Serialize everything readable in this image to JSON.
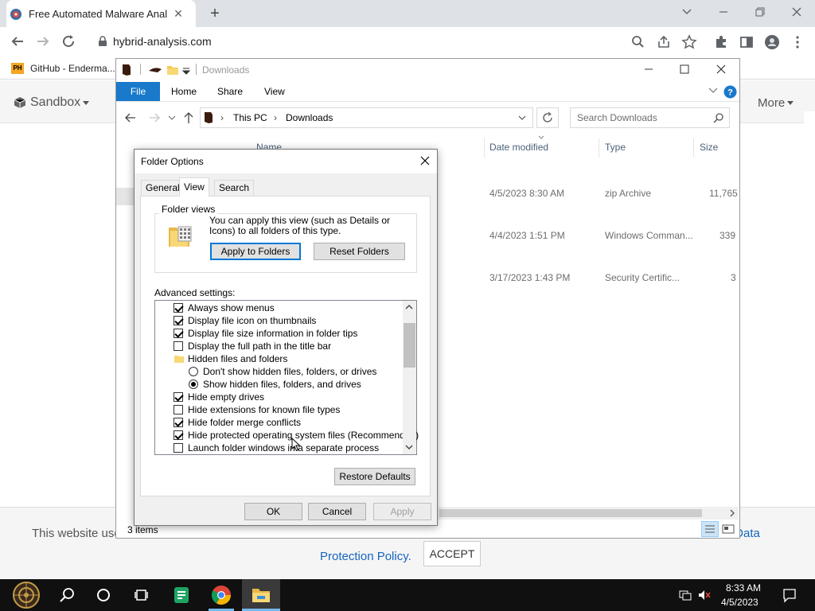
{
  "browser": {
    "tab_title": "Free Automated Malware Anal",
    "url": "hybrid-analysis.com",
    "bookmark_label": "GitHub - Enderma...",
    "bookmark_badge": "PH",
    "new_tab": "+",
    "tab_close": "✕"
  },
  "page": {
    "nav_sandbox": "Sandbox",
    "nav_more": "More",
    "cookie_text_start": "This website use",
    "cookie_text_end": "r Data",
    "cookie_link": "Protection Policy.",
    "accept_label": "ACCEPT"
  },
  "explorer": {
    "title": "Downloads",
    "ribbon": {
      "file": "File",
      "home": "Home",
      "share": "Share",
      "view": "View"
    },
    "breadcrumb": [
      "This PC",
      "Downloads"
    ],
    "search_placeholder": "Search Downloads",
    "columns": {
      "name": "Name",
      "date": "Date modified",
      "type": "Type",
      "size": "Size"
    },
    "rows": [
      {
        "date": "4/5/2023 8:30 AM",
        "type": "zip Archive",
        "size": "11,765"
      },
      {
        "date": "4/4/2023 1:51 PM",
        "type": "Windows Comman...",
        "size": "339"
      },
      {
        "date": "3/17/2023 1:43 PM",
        "type": "Security Certific...",
        "size": "3"
      }
    ],
    "status": "3 items"
  },
  "dialog": {
    "title": "Folder Options",
    "tabs": {
      "general": "General",
      "view": "View",
      "search": "Search"
    },
    "folder_views": {
      "label": "Folder views",
      "text": "You can apply this view (such as Details or Icons) to all folders of this type.",
      "apply_btn": "Apply to Folders",
      "reset_btn": "Reset Folders"
    },
    "advanced_label": "Advanced settings:",
    "advanced_items": [
      {
        "kind": "check",
        "checked": true,
        "label": "Always show menus"
      },
      {
        "kind": "check",
        "checked": true,
        "label": "Display file icon on thumbnails"
      },
      {
        "kind": "check",
        "checked": true,
        "label": "Display file size information in folder tips"
      },
      {
        "kind": "check",
        "checked": false,
        "label": "Display the full path in the title bar"
      },
      {
        "kind": "folder",
        "checked": false,
        "label": "Hidden files and folders"
      },
      {
        "kind": "radio",
        "checked": false,
        "label": "Don't show hidden files, folders, or drives"
      },
      {
        "kind": "radio",
        "checked": true,
        "label": "Show hidden files, folders, and drives"
      },
      {
        "kind": "check",
        "checked": true,
        "label": "Hide empty drives"
      },
      {
        "kind": "check",
        "checked": false,
        "label": "Hide extensions for known file types"
      },
      {
        "kind": "check",
        "checked": true,
        "label": "Hide folder merge conflicts"
      },
      {
        "kind": "check",
        "checked": true,
        "label": "Hide protected operating system files (Recommended)"
      },
      {
        "kind": "check",
        "checked": false,
        "label": "Launch folder windows in a separate process"
      }
    ],
    "restore_btn": "Restore Defaults",
    "ok_btn": "OK",
    "cancel_btn": "Cancel",
    "apply_btn": "Apply"
  },
  "taskbar": {
    "time": "8:33 AM",
    "date": "4/5/2023"
  }
}
